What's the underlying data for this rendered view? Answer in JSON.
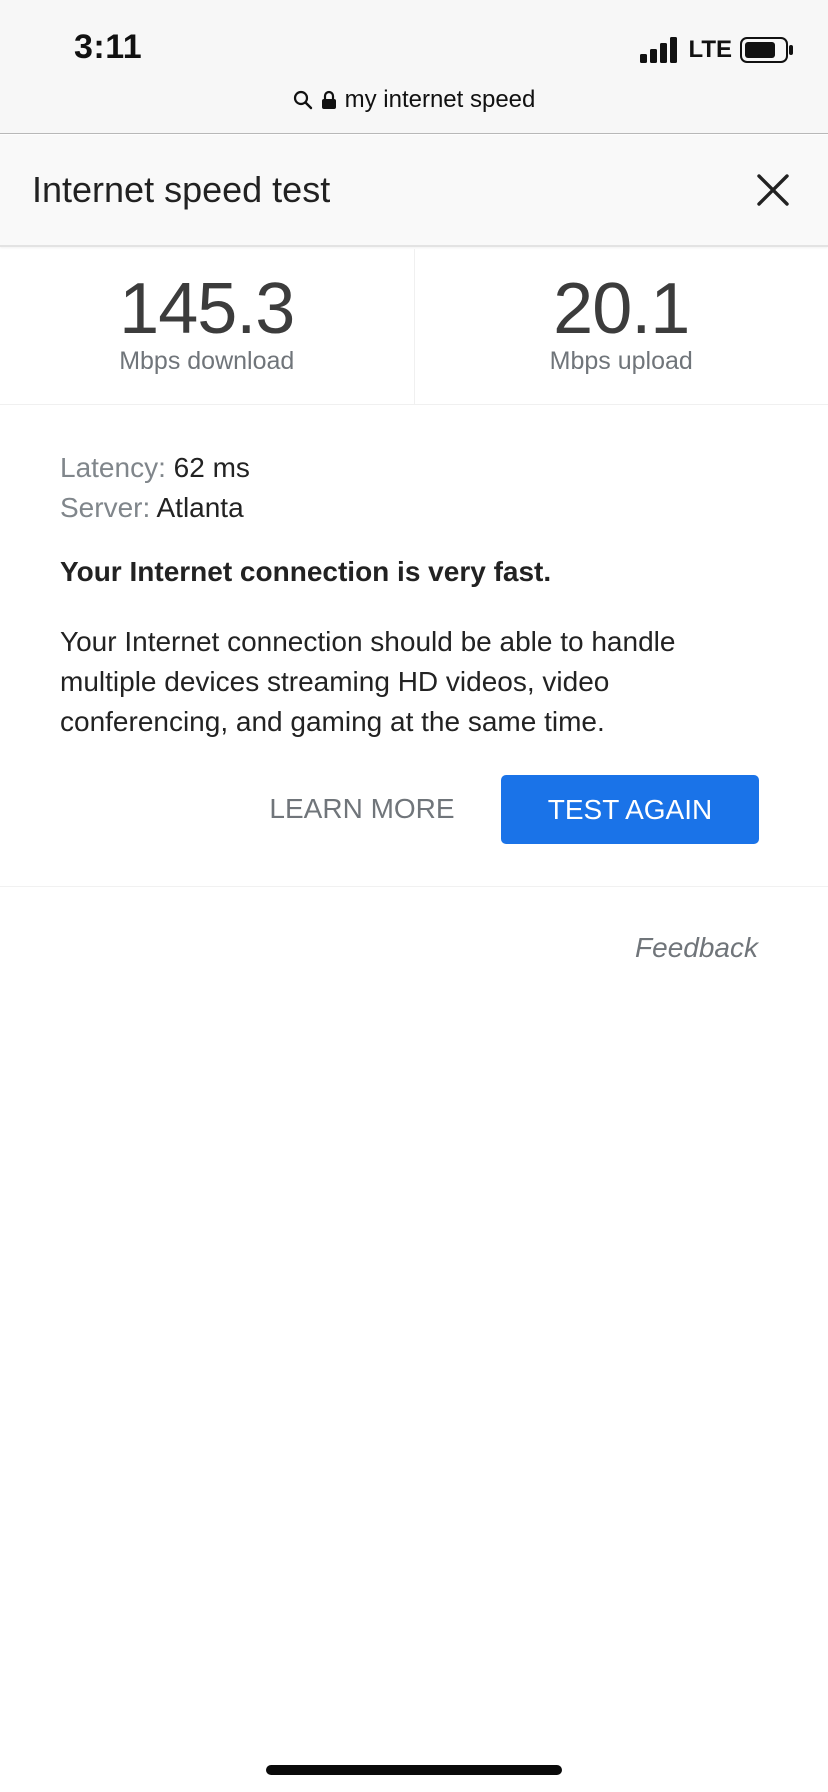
{
  "status_bar": {
    "time": "3:11",
    "network": "LTE",
    "icons": [
      "signal-icon",
      "battery-icon"
    ]
  },
  "url_bar": {
    "text": "my internet speed",
    "icons": [
      "search-icon",
      "lock-icon"
    ]
  },
  "header": {
    "title": "Internet speed test",
    "close_icon": "close-icon"
  },
  "speeds": {
    "download_value": "145.3",
    "download_unit": "Mbps download",
    "upload_value": "20.1",
    "upload_unit": "Mbps upload"
  },
  "details": {
    "latency_label": "Latency:",
    "latency_value": "62 ms",
    "server_label": "Server:",
    "server_value": "Atlanta"
  },
  "verdict": "Your Internet connection is very fast.",
  "description": "Your Internet connection should be able to handle multiple devices streaming HD videos, video conferencing, and gaming at the same time.",
  "actions": {
    "learn_more": "LEARN MORE",
    "test_again": "TEST AGAIN"
  },
  "feedback": "Feedback",
  "colors": {
    "accent": "#1a73e8",
    "muted_text": "#70757a",
    "primary_text": "#202124"
  }
}
